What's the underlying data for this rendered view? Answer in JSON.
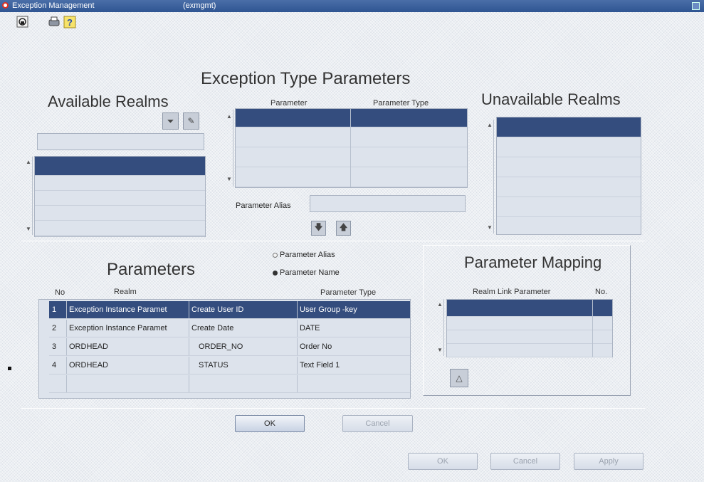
{
  "window": {
    "title": "Exception Management",
    "subtitle": "(exmgmt)"
  },
  "toolbar": {
    "icons": [
      "lock-icon",
      "printer-icon",
      "help-icon"
    ]
  },
  "exception_type_parameters": {
    "heading": "Exception Type Parameters",
    "columns": [
      "Parameter",
      "Parameter Type"
    ],
    "alias_label": "Parameter Alias",
    "alias_value": ""
  },
  "available_realms": {
    "heading": "Available Realms",
    "filter_value": ""
  },
  "unavailable_realms": {
    "heading": "Unavailable Realms"
  },
  "parameters": {
    "heading": "Parameters",
    "radio_alias": "Parameter Alias",
    "radio_name": "Parameter Name",
    "selected_radio": "Parameter Name",
    "columns": {
      "no": "No",
      "realm": "Realm",
      "parameter": "",
      "type": "Parameter Type"
    },
    "rows": [
      {
        "no": "1",
        "realm": "Exception Instance Paramet",
        "parameter": "Create User ID",
        "type": "User Group -key"
      },
      {
        "no": "2",
        "realm": "Exception Instance Paramet",
        "parameter": "Create Date",
        "type": "DATE"
      },
      {
        "no": "3",
        "realm": "ORDHEAD",
        "parameter": "ORDER_NO",
        "type": "Order No"
      },
      {
        "no": "4",
        "realm": "ORDHEAD",
        "parameter": "STATUS",
        "type": "Text Field 1"
      }
    ]
  },
  "parameter_mapping": {
    "heading": "Parameter Mapping",
    "columns": [
      "Realm Link Parameter",
      "No."
    ]
  },
  "buttons": {
    "ok_inner": "OK",
    "cancel_inner": "Cancel",
    "ok": "OK",
    "cancel": "Cancel",
    "apply": "Apply"
  },
  "colors": {
    "titlebar": "#2f5592",
    "selection": "#344d7e",
    "list_bg": "#dde3ec"
  }
}
